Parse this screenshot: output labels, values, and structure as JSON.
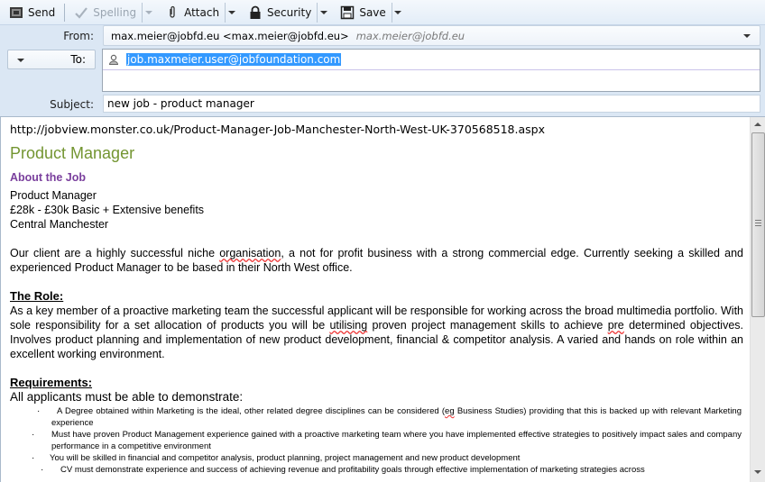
{
  "toolbar": {
    "send": {
      "label": "Send",
      "icon": "send-icon"
    },
    "spelling": {
      "label": "Spelling",
      "icon": "checkmark-icon",
      "disabled": true
    },
    "attach": {
      "label": "Attach",
      "icon": "paperclip-icon"
    },
    "security": {
      "label": "Security",
      "icon": "lock-icon"
    },
    "save": {
      "label": "Save",
      "icon": "floppy-disk-icon"
    }
  },
  "header": {
    "from_label": "From:",
    "from_value": "max.meier@jobfd.eu <max.meier@jobfd.eu>",
    "from_identity": "max.meier@jobfd.eu",
    "to_label": "To:",
    "to_value": "job.maxmeier.user@jobfoundation.com",
    "subject_label": "Subject:",
    "subject_value": "new job - product manager"
  },
  "body": {
    "url": "http://jobview.monster.co.uk/Product-Manager-Job-Manchester-North-West-UK-370568518.aspx",
    "title": "Product Manager",
    "about_heading": "About the Job",
    "summary_lines": [
      "Product Manager",
      "£28k - £30k Basic + Extensive benefits",
      "Central Manchester"
    ],
    "intro_before": "Our client are a highly successful niche ",
    "intro_misspelled": "organisation",
    "intro_after": ", a not for profit business with a strong commercial edge.  Currently seeking a skilled and experienced Product Manager to be based in their North West office.",
    "role_heading": "The Role:",
    "role_before": "As a key member of a proactive marketing team the successful applicant will be responsible for working across the broad multimedia portfolio.  With sole responsibility for a set allocation of products you will be ",
    "role_misspelled1": "utilising",
    "role_middle": " proven project management skills to achieve ",
    "role_misspelled2": "pre",
    "role_after": " determined objectives.  Involves product planning and implementation of new product development, financial & competitor analysis.  A varied and hands on role within an excellent working environment.",
    "requirements_heading": "Requirements:",
    "requirements_intro": "All applicants must be able to demonstrate:",
    "requirements": [
      {
        "before": "A Degree obtained within Marketing is the ideal, other related degree disciplines can be considered (",
        "misspelled": "eg",
        "after": " Business Studies) providing that this is backed up with relevant Marketing experience"
      },
      {
        "before": "Must have proven Product Management experience gained with a proactive marketing team where you have implemented effective strategies to positively impact sales and company performance in a competitive environment",
        "misspelled": "",
        "after": ""
      },
      {
        "before": "You will be skilled in financial and competitor analysis, product planning, project management and new product development",
        "misspelled": "",
        "after": ""
      },
      {
        "before": "CV must demonstrate experience and success of achieving revenue and profitability goals through effective implementation of marketing strategies across",
        "misspelled": "",
        "after": ""
      }
    ]
  },
  "colors": {
    "title": "#739531",
    "about_heading": "#7a3f9d",
    "selection": "#3399ff"
  }
}
